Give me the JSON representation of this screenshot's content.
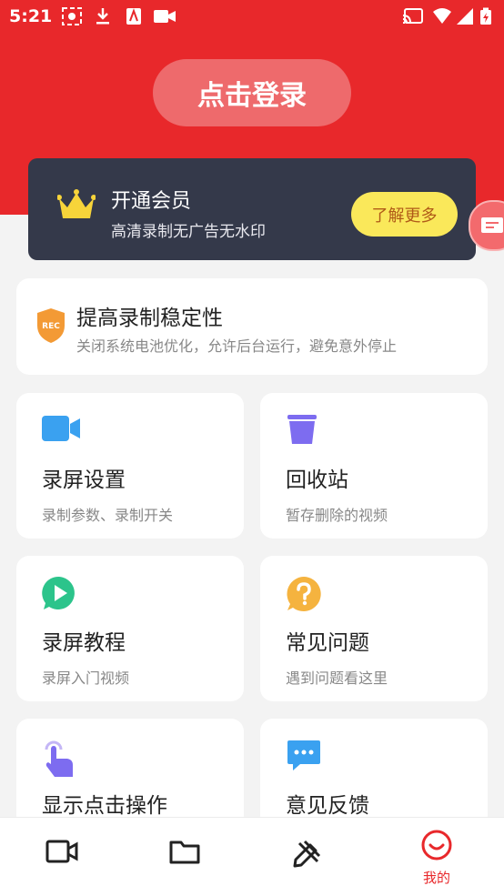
{
  "status_bar": {
    "time": "5:21"
  },
  "header": {
    "login_label": "点击登录"
  },
  "vip": {
    "title": "开通会员",
    "subtitle": "高清录制无广告无水印",
    "more_label": "了解更多"
  },
  "stability": {
    "title": "提高录制稳定性",
    "subtitle": "关闭系统电池优化，允许后台运行，避免意外停止",
    "badge_text": "REC"
  },
  "tiles": [
    {
      "title": "录屏设置",
      "subtitle": "录制参数、录制开关",
      "icon": "video-camera-icon"
    },
    {
      "title": "回收站",
      "subtitle": "暂存删除的视频",
      "icon": "trash-bin-icon"
    },
    {
      "title": "录屏教程",
      "subtitle": "录屏入门视频",
      "icon": "play-bubble-icon"
    },
    {
      "title": "常见问题",
      "subtitle": "遇到问题看这里",
      "icon": "question-icon"
    },
    {
      "title": "显示点击操作",
      "subtitle": "",
      "icon": "tap-hand-icon"
    },
    {
      "title": "意见反馈",
      "subtitle": "",
      "icon": "chat-bubble-icon"
    }
  ],
  "bottom_nav": {
    "items": [
      {
        "icon": "video-icon",
        "label": ""
      },
      {
        "icon": "folder-icon",
        "label": ""
      },
      {
        "icon": "edit-tools-icon",
        "label": ""
      },
      {
        "icon": "smile-icon",
        "label": "我的",
        "active": true
      }
    ]
  },
  "colors": {
    "primary_red": "#e8282b",
    "vip_card": "#34394a",
    "vip_button": "#fae85a",
    "accent_blue": "#3aa1f0",
    "accent_purple": "#7d6cf0",
    "accent_green": "#2cc48b",
    "accent_orange": "#f5b33f"
  }
}
